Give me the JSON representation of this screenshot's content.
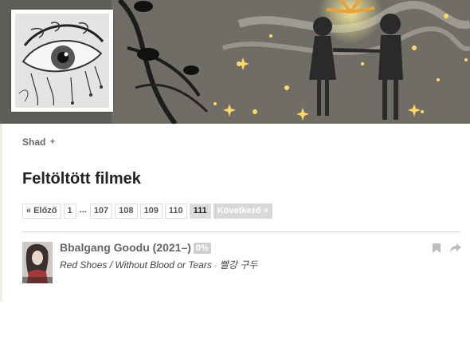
{
  "profile": {
    "username": "Shad",
    "username_icon": "user-settings-icon"
  },
  "page": {
    "title": "Feltöltött filmek"
  },
  "pager": {
    "prev": "« Előző",
    "first": "1",
    "ellipsis": "...",
    "pages": [
      "107",
      "108",
      "109",
      "110"
    ],
    "current": "111",
    "next": "Következő »"
  },
  "film": {
    "title": "Bbalgang Goodu (2021–)",
    "badge": "0%",
    "alt_titles": "Red Shoes / Without Blood or Tears",
    "separator": "·",
    "original_title": "빨강 구두",
    "icons": [
      "bookmark-icon",
      "share-icon"
    ]
  },
  "colors": {
    "current_page_bg": "#dddddd",
    "disabled_next_bg": "#d8d8d8",
    "badge_bg": "#cfcfcf"
  }
}
